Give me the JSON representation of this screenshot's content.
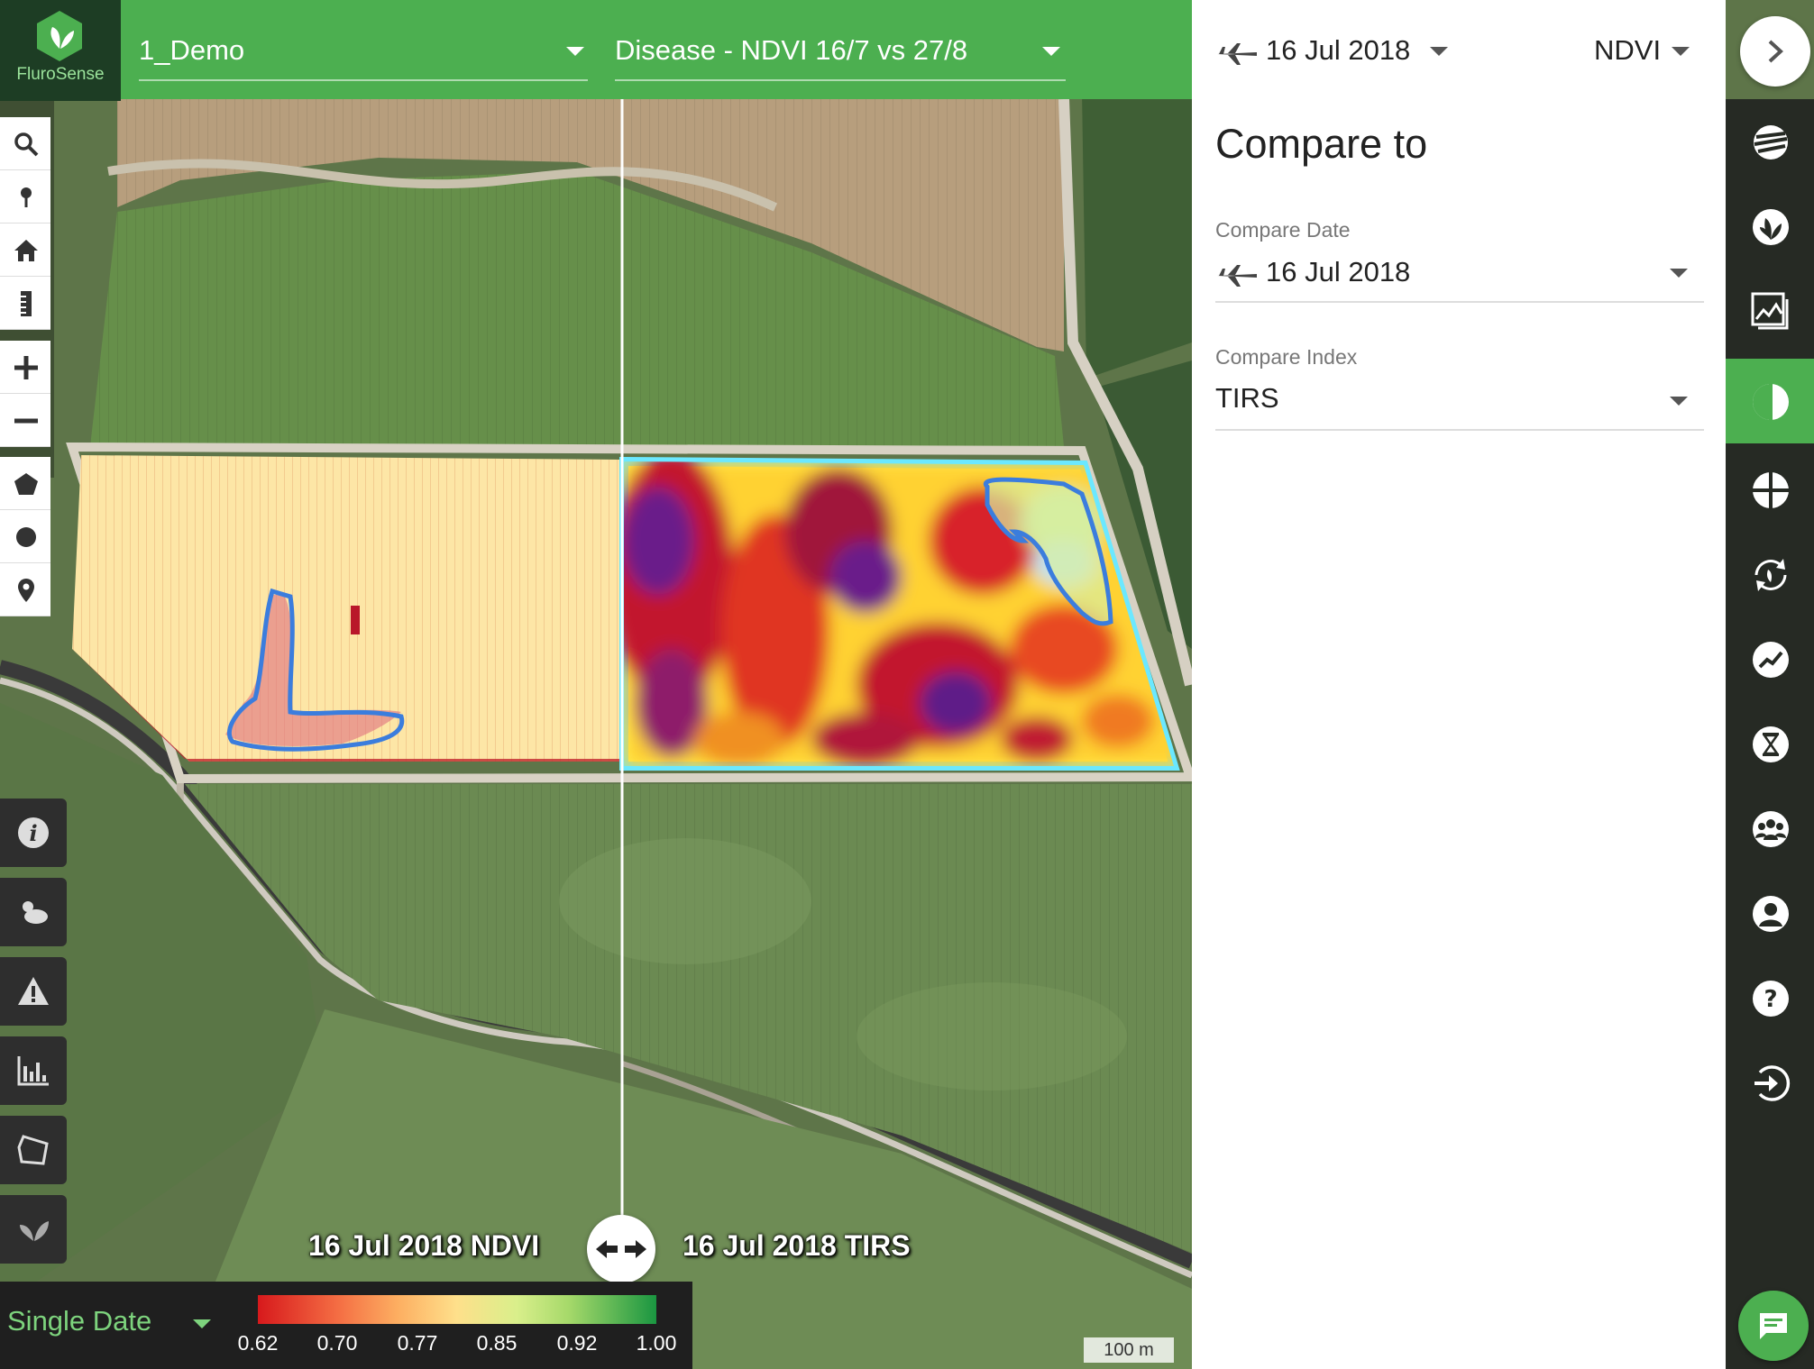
{
  "app": {
    "name": "FluroSense"
  },
  "header": {
    "farm_select": "1_Demo",
    "layer_select": "Disease - NDVI 16/7 vs 27/8"
  },
  "panel": {
    "date": "16 Jul 2018",
    "index": "NDVI",
    "title": "Compare to",
    "compare_date_label": "Compare Date",
    "compare_date_value": "16 Jul 2018",
    "compare_index_label": "Compare Index",
    "compare_index_value": "TIRS"
  },
  "map": {
    "left_label": "16 Jul 2018 NDVI",
    "right_label": "16 Jul 2018 TIRS",
    "scale_label": "100 m"
  },
  "legend": {
    "mode": "Single Date",
    "ticks": [
      "0.62",
      "0.70",
      "0.77",
      "0.85",
      "0.92",
      "1.00"
    ],
    "colors": [
      "#d7191c",
      "#fdae61",
      "#fee08b",
      "#a6d96a",
      "#1a9641"
    ]
  },
  "colors": {
    "accent": "#4caf50",
    "sidebar": "#262a24"
  },
  "left_toolbar_icons": [
    "search-icon",
    "pin-icon",
    "home-icon",
    "ruler-icon",
    "zoom-in-icon",
    "zoom-out-icon",
    "polygon-icon",
    "circle-icon",
    "marker-icon"
  ],
  "left_panel_icons": [
    "info-icon",
    "weather-icon",
    "alert-icon",
    "chart-icon",
    "field-shape-icon",
    "leaf-icon"
  ],
  "right_sidebar_icons": [
    "layers-icon",
    "crop-icon",
    "images-icon",
    "compare-icon",
    "grid-icon",
    "refresh-icon",
    "trend-icon",
    "hourglass-icon",
    "team-icon",
    "user-icon",
    "help-icon",
    "logout-icon"
  ]
}
